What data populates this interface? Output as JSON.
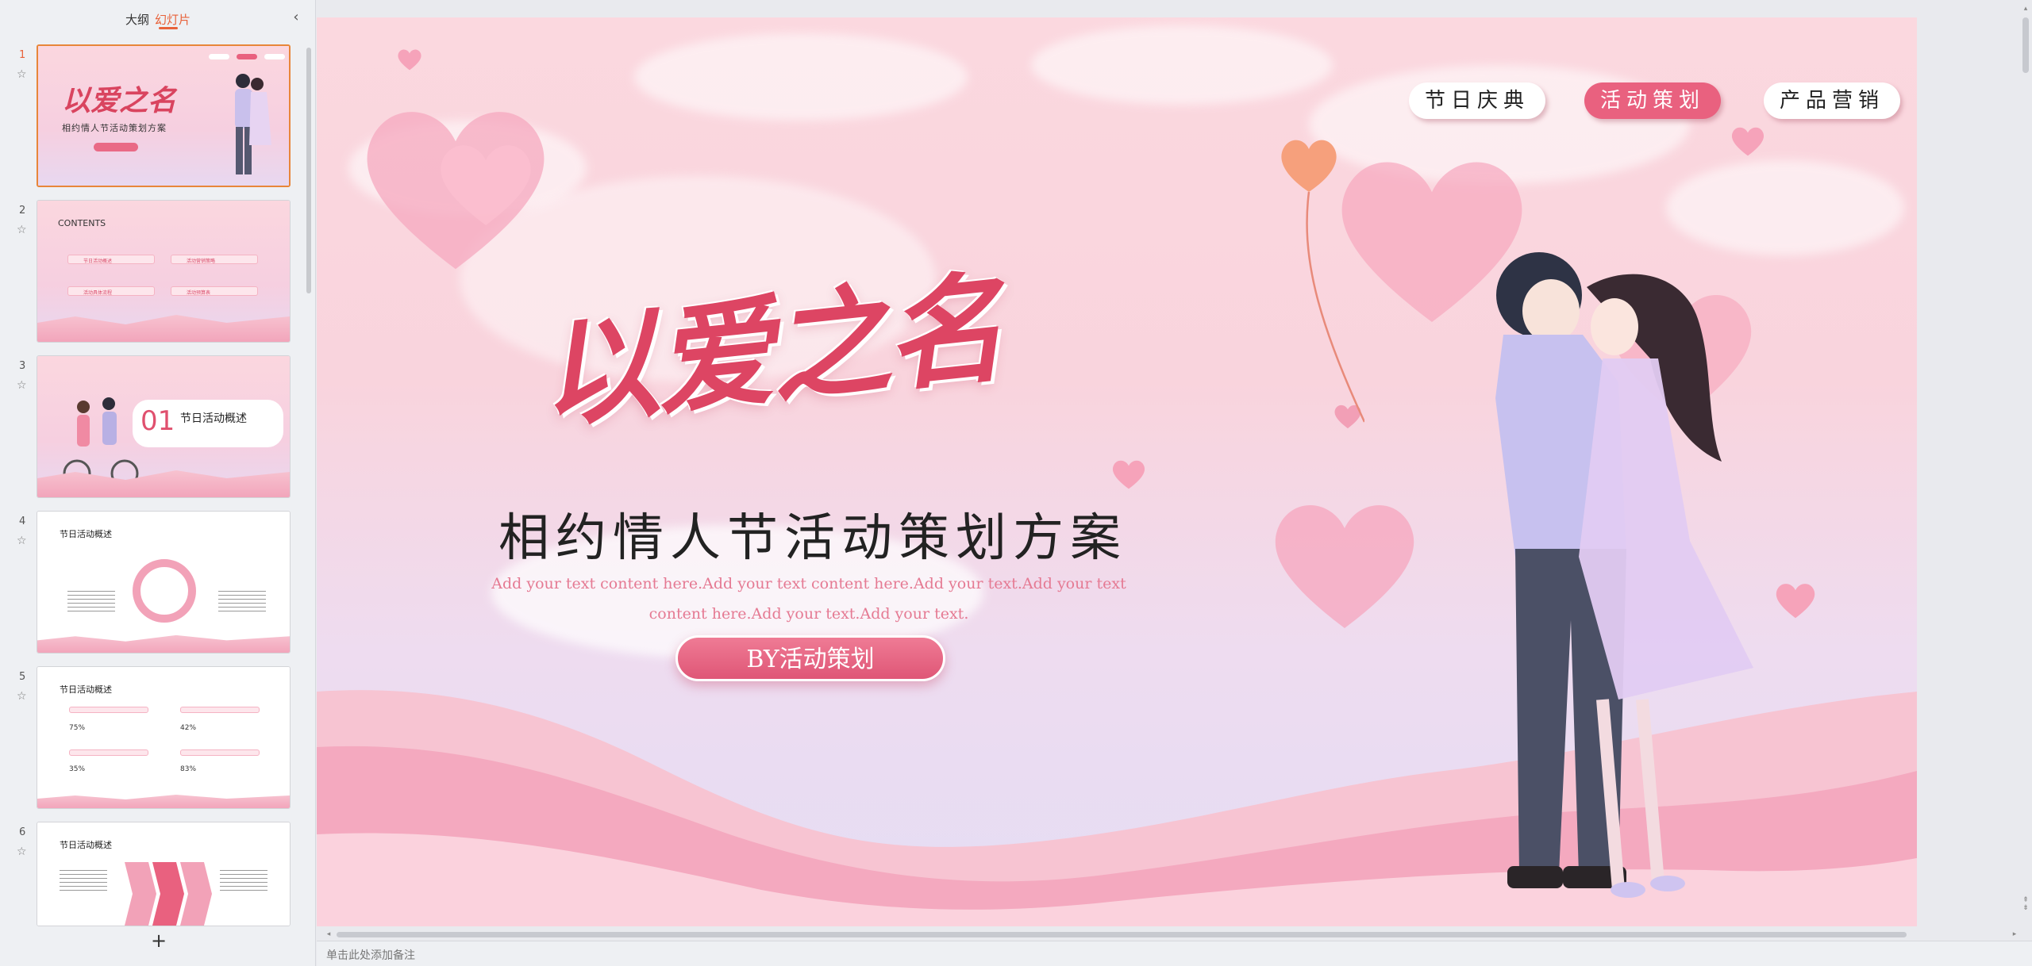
{
  "panel": {
    "tab_outline": "大纲",
    "tab_slides": "幻灯片",
    "collapse_icon": "‹",
    "add_slide_icon": "+"
  },
  "thumbnails": [
    {
      "number": "1",
      "title": "以爱之名",
      "subtitle": "相约情人节活动策划方案"
    },
    {
      "number": "2",
      "heading": "CONTENTS",
      "items": [
        "节日活动概述",
        "活动营销策略",
        "活动具体流程",
        "活动预算表"
      ]
    },
    {
      "number": "3",
      "num": "01",
      "title": "节日活动概述"
    },
    {
      "number": "4",
      "heading": "节日活动概述"
    },
    {
      "number": "5",
      "heading": "节日活动概述",
      "percents": [
        "75%",
        "42%",
        "35%",
        "83%"
      ]
    },
    {
      "number": "6",
      "heading": "节日活动概述"
    }
  ],
  "slide": {
    "nav": [
      "节日庆典",
      "活动策划",
      "产品营销"
    ],
    "title": "以爱之名",
    "subtitle": "相约情人节活动策划方案",
    "body_line1": "Add your text content here.Add your text content here.Add your text.Add your text",
    "body_line2": "content here.Add your text.Add your text.",
    "button": "BY活动策划"
  },
  "notes": {
    "placeholder": "单击此处添加备注"
  },
  "colors": {
    "accent": "#e8623a",
    "brand_pink": "#e9617f",
    "title_pink": "#dd4563"
  }
}
